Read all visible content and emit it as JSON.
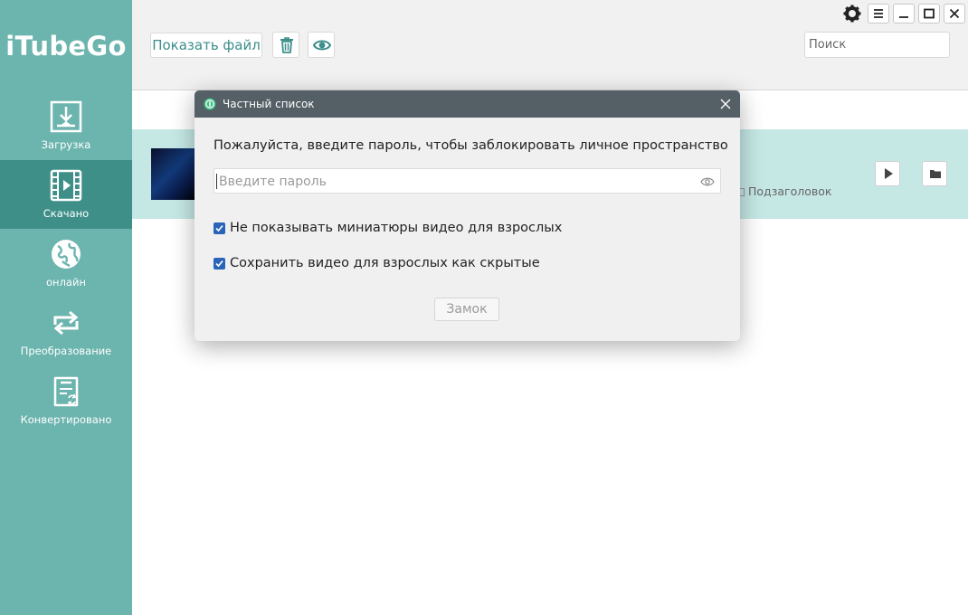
{
  "app": {
    "logo": "iTubeGo"
  },
  "sidebar": {
    "items": [
      {
        "label": "Загрузка",
        "icon": "download-icon",
        "active": false
      },
      {
        "label": "Скачано",
        "icon": "film-icon",
        "active": true
      },
      {
        "label": "онлайн",
        "icon": "globe-icon",
        "active": false
      },
      {
        "label": "Преобразование",
        "icon": "convert-arrows-icon",
        "active": false
      },
      {
        "label": "Конвертировано",
        "icon": "converted-doc-icon",
        "active": false
      }
    ]
  },
  "toolbar": {
    "show_file_label": "Показать файл",
    "delete_icon": "trash-icon",
    "private_icon": "eye-icon",
    "search_placeholder": "Поиск"
  },
  "window_controls": [
    "gear-icon",
    "menu-icon",
    "minimize-icon",
    "maximize-icon",
    "close-icon"
  ],
  "download_row": {
    "subtitle_label": "Подзаголовок"
  },
  "modal": {
    "title": "Частный список",
    "prompt": "Пожалуйста, введите пароль, чтобы заблокировать личное пространство",
    "password_placeholder": "Введите пароль",
    "options": [
      {
        "label": "Не показывать миниатюры видео для взрослых",
        "checked": true
      },
      {
        "label": "Сохранить видео для взрослых как скрытые",
        "checked": true
      }
    ],
    "lock_label": "Замок"
  },
  "colors": {
    "sidebar": "#6cb4ae",
    "sidebar_active": "#3f8f89",
    "accent": "#3b8e89",
    "row_highlight": "#c5e8e5",
    "modal_title_bar": "#555f66",
    "checkbox": "#2a64b8"
  }
}
